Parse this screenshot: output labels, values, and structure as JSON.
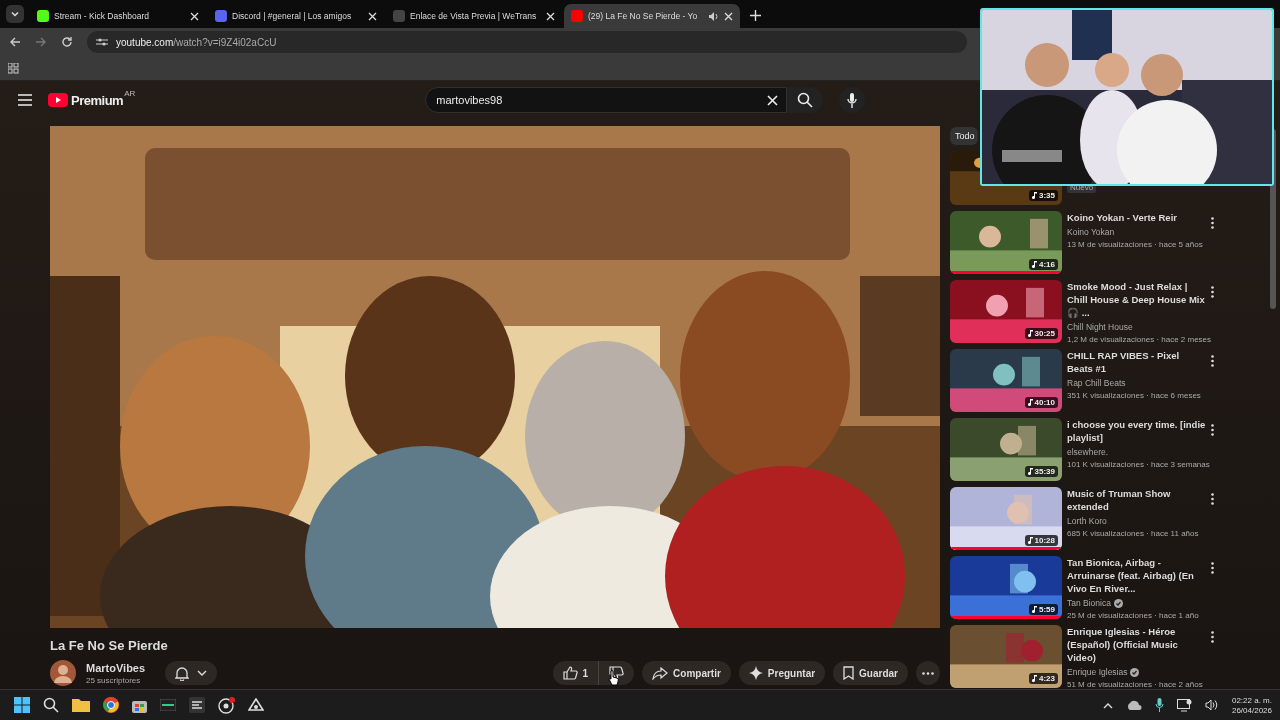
{
  "browser": {
    "tabs": [
      {
        "title": "Stream - Kick Dashboard",
        "selected": false,
        "color": "#53fc18",
        "audio": false
      },
      {
        "title": "Discord | #general | Los amigos",
        "selected": false,
        "color": "#5865f2",
        "audio": false
      },
      {
        "title": "Enlace de Vista Previa | WeTrans",
        "selected": false,
        "color": "#444444",
        "audio": false
      },
      {
        "title": "(29) La Fe No Se Pierde - Yo",
        "selected": true,
        "color": "#ff0000",
        "audio": true
      }
    ],
    "url_host": "youtube.com",
    "url_path": "/watch?v=i9Z4i02aCcU"
  },
  "header": {
    "logo": "Premium",
    "region": "AR",
    "search": "martovibes98"
  },
  "video": {
    "title": "La Fe No Se Pierde",
    "channel": "MartoVibes",
    "subscribers": "25 suscriptores",
    "likes": "1",
    "actions": [
      {
        "kind": "share",
        "label": "Compartir"
      },
      {
        "kind": "ask",
        "label": "Preguntar"
      },
      {
        "kind": "save",
        "label": "Guardar"
      }
    ]
  },
  "sidebar": {
    "chip": "Todo",
    "first": {
      "badge": "Nuevo",
      "duration": "3:35"
    },
    "items": [
      {
        "title": "Koino Yokan - Verte Reir",
        "channel": "Koino Yokan",
        "verified": false,
        "meta": "13 M de visualizaciones · hace 5 años",
        "duration": "4:16",
        "watched": true
      },
      {
        "title": "Smoke Mood - Just Relax | Chill House & Deep House Mix 🎧 ...",
        "channel": "Chill Night House",
        "verified": false,
        "meta": "1,2 M de visualizaciones · hace 2 meses",
        "duration": "30:25",
        "watched": false
      },
      {
        "title": "CHILL RAP VIBES - Pixel Beats #1",
        "channel": "Rap Chill Beats",
        "verified": false,
        "meta": "351 K visualizaciones · hace 6 meses",
        "duration": "40:10",
        "watched": false
      },
      {
        "title": "i choose you every time. [indie playlist]",
        "channel": "elsewhere.",
        "verified": false,
        "meta": "101 K visualizaciones · hace 3 semanas",
        "duration": "35:39",
        "watched": false
      },
      {
        "title": "Music of Truman Show extended",
        "channel": "Lorth Koro",
        "verified": false,
        "meta": "685 K visualizaciones · hace 11 años",
        "duration": "10:28",
        "watched": true
      },
      {
        "title": "Tan Bionica, Airbag - Arruinarse (feat. Airbag) (En Vivo En River...",
        "channel": "Tan Bionica",
        "verified": true,
        "meta": "25 M de visualizaciones · hace 1 año",
        "duration": "5:59",
        "watched": true
      },
      {
        "title": "Enrique Iglesias - Héroe (Español) (Official Music Video)",
        "channel": "Enrique Iglesias",
        "verified": true,
        "meta": "51 M de visualizaciones · hace 2 años",
        "duration": "4:23",
        "watched": false
      }
    ]
  },
  "taskbar": {
    "time": "02:22 a. m.",
    "date": "26/04/2026"
  }
}
